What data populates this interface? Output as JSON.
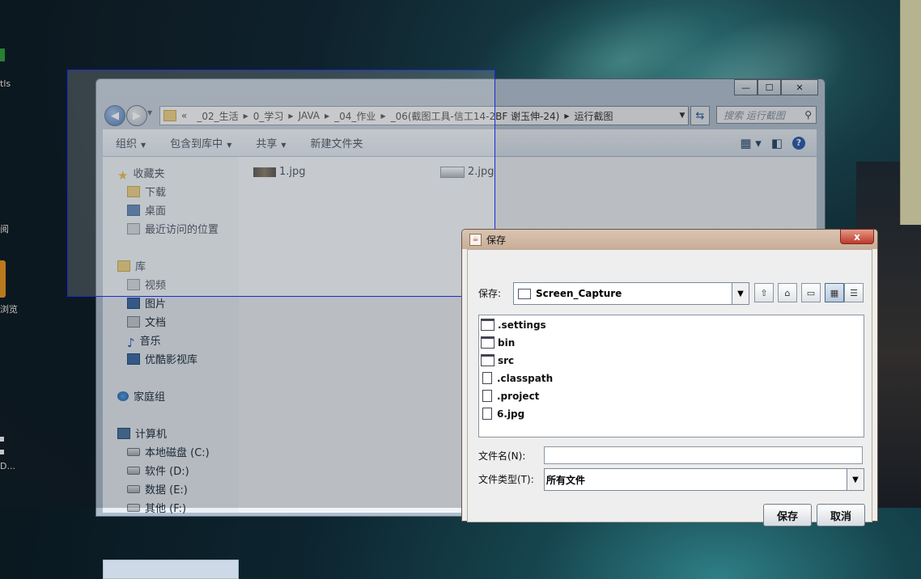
{
  "desktop": {
    "label_top": "tls",
    "label_mid": "阅",
    "label_browse": "浏览",
    "label_bottom": "D..."
  },
  "explorer": {
    "window_buttons": {
      "minimize": "—",
      "maximize": "☐",
      "close": "✕"
    },
    "address": {
      "prefix": "«",
      "crumbs": [
        "_02_生活",
        "0_学习",
        "JAVA",
        "_04_作业",
        "_06(截图工具-信工14-2BF 谢玉伸-24)",
        "运行截图"
      ]
    },
    "search_placeholder": "搜索 运行截图",
    "toolbar": {
      "organize": "组织",
      "include_library": "包含到库中",
      "share": "共享",
      "new_folder": "新建文件夹"
    },
    "sidebar": {
      "favorites": "收藏夹",
      "downloads": "下载",
      "desktop": "桌面",
      "recent": "最近访问的位置",
      "libraries": "库",
      "videos": "视频",
      "pictures": "图片",
      "documents": "文档",
      "music": "音乐",
      "youku": "优酷影视库",
      "homegroup": "家庭组",
      "computer": "计算机",
      "drive_c": "本地磁盘 (C:)",
      "drive_d": "软件 (D:)",
      "drive_e": "数据 (E:)",
      "drive_f": "其他 (F:)"
    },
    "files": [
      "1.jpg",
      "2.jpg"
    ]
  },
  "dialog": {
    "title": "保存",
    "close_label": "x",
    "save_in_label": "保存:",
    "save_in_value": "Screen_Capture",
    "items": [
      ".settings",
      "bin",
      "src",
      ".classpath",
      ".project",
      "6.jpg"
    ],
    "filename_label": "文件名(N):",
    "filename_value": "",
    "filetype_label": "文件类型(T):",
    "filetype_value": "所有文件",
    "save_button": "保存",
    "cancel_button": "取消"
  }
}
